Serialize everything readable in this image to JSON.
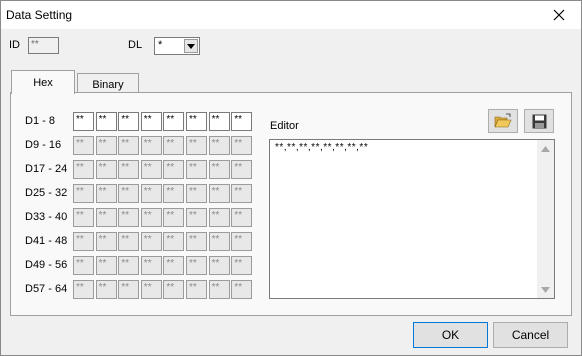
{
  "window": {
    "title": "Data Setting"
  },
  "header": {
    "id_label": "ID",
    "id_value": "**",
    "dl_label": "DL",
    "dl_value": "*"
  },
  "tabs": [
    {
      "label": "Hex",
      "active": true
    },
    {
      "label": "Binary",
      "active": false
    }
  ],
  "grid": {
    "rows": [
      {
        "label": "D1 - 8",
        "cells": [
          "**",
          "**",
          "**",
          "**",
          "**",
          "**",
          "**",
          "**"
        ]
      },
      {
        "label": "D9 - 16",
        "cells": [
          "**",
          "**",
          "**",
          "**",
          "**",
          "**",
          "**",
          "**"
        ]
      },
      {
        "label": "D17 - 24",
        "cells": [
          "**",
          "**",
          "**",
          "**",
          "**",
          "**",
          "**",
          "**"
        ]
      },
      {
        "label": "D25 - 32",
        "cells": [
          "**",
          "**",
          "**",
          "**",
          "**",
          "**",
          "**",
          "**"
        ]
      },
      {
        "label": "D33 - 40",
        "cells": [
          "**",
          "**",
          "**",
          "**",
          "**",
          "**",
          "**",
          "**"
        ]
      },
      {
        "label": "D41 - 48",
        "cells": [
          "**",
          "**",
          "**",
          "**",
          "**",
          "**",
          "**",
          "**"
        ]
      },
      {
        "label": "D49 - 56",
        "cells": [
          "**",
          "**",
          "**",
          "**",
          "**",
          "**",
          "**",
          "**"
        ]
      },
      {
        "label": "D57 - 64",
        "cells": [
          "**",
          "**",
          "**",
          "**",
          "**",
          "**",
          "**",
          "**"
        ]
      }
    ]
  },
  "editor": {
    "label": "Editor",
    "text": "**,**,**,**,**,**,**,**"
  },
  "buttons": {
    "ok": "OK",
    "cancel": "Cancel"
  }
}
